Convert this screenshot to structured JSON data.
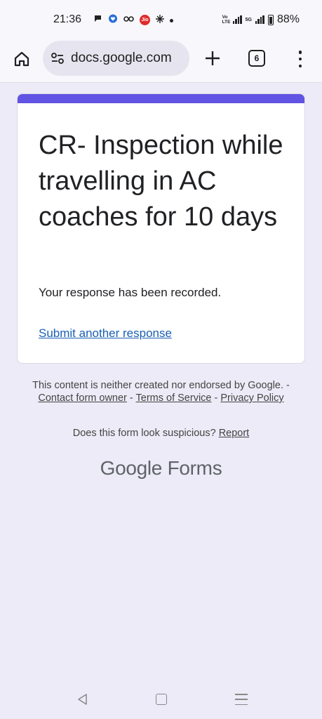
{
  "status_bar": {
    "time": "21:36",
    "jio_label": "Jio",
    "battery_percent": "88%",
    "network_label_left": "Vo LTE",
    "network_label_right": "5G"
  },
  "toolbar": {
    "url": "docs.google.com",
    "tab_count": "6",
    "icons": {
      "home": "home-icon",
      "site_info": "tune-icon",
      "new_tab": "plus-icon",
      "tabs": "tab-switcher-icon",
      "menu": "more-vert-icon"
    }
  },
  "form": {
    "accent_color": "#6153e3",
    "title": "CR-  Inspection while travelling in AC coaches for 10 days",
    "confirmation": "Your response has been recorded.",
    "submit_another": "Submit another response"
  },
  "footer": {
    "disclaimer_prefix": "This content is neither created nor endorsed by Google. - ",
    "contact_owner": "Contact form owner",
    "sep1": " - ",
    "terms": "Terms of Service",
    "sep2": " - ",
    "privacy": "Privacy Policy",
    "suspicious_prefix": "Does this form look suspicious? ",
    "report": "Report",
    "logo_google": "Google",
    "logo_forms": " Forms"
  }
}
